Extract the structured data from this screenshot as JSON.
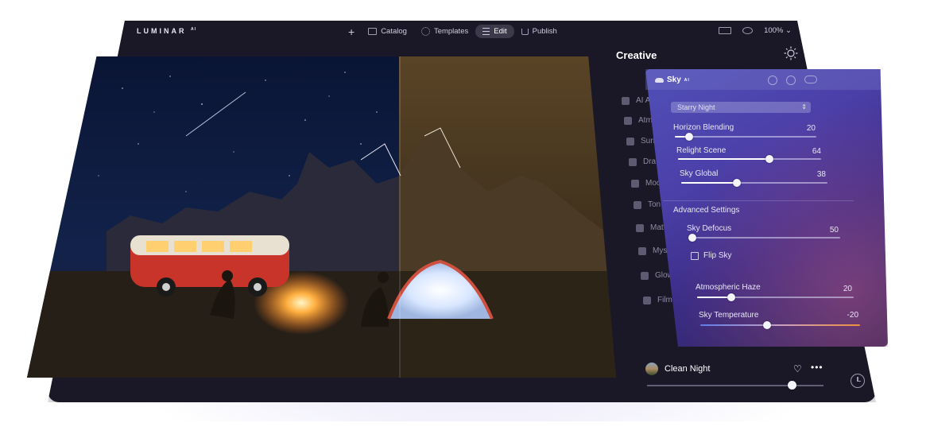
{
  "app": {
    "logo_text": "LUMINAR",
    "logo_sup": "AI"
  },
  "topbar": {
    "nav": [
      {
        "label": "Catalog",
        "icon": "folder-icon"
      },
      {
        "label": "Templates",
        "icon": "templates-icon"
      },
      {
        "label": "Edit",
        "icon": "edit-icon",
        "active": true
      },
      {
        "label": "Publish",
        "icon": "share-icon"
      }
    ],
    "zoom": "100%"
  },
  "sidebar": {
    "title": "Creative",
    "tools": [
      {
        "label": "AI A",
        "icon": "ai-icon"
      },
      {
        "label": "Atm",
        "icon": "atmosphere-icon"
      },
      {
        "label": "Sun",
        "icon": "sun-rays-icon"
      },
      {
        "label": "Dra",
        "icon": "drama-icon"
      },
      {
        "label": "Moo",
        "icon": "mood-icon"
      },
      {
        "label": "Ton",
        "icon": "toning-icon"
      },
      {
        "label": "Matt",
        "icon": "matte-icon"
      },
      {
        "label": "Myst",
        "icon": "mystical-icon"
      },
      {
        "label": "Glow",
        "icon": "glow-icon"
      },
      {
        "label": "Film",
        "icon": "film-icon"
      }
    ]
  },
  "sky_panel": {
    "title": "Sky",
    "title_sup": "AI",
    "preset_select": "Starry Night",
    "sliders": [
      {
        "label": "Horizon Blending",
        "value": "20",
        "fraction": 0.1
      },
      {
        "label": "Relight Scene",
        "value": "64",
        "fraction": 0.64
      },
      {
        "label": "Sky Global",
        "value": "38",
        "fraction": 0.38
      }
    ],
    "advanced_title": "Advanced Settings",
    "advanced_sliders": [
      {
        "label": "Sky Defocus",
        "value": "50",
        "fraction": 0.0
      }
    ],
    "flip_label": "Flip Sky",
    "flip_checked": false,
    "lower_sliders": [
      {
        "label": "Atmospheric Haze",
        "value": "20",
        "fraction": 0.22
      },
      {
        "label": "Sky Temperature",
        "value": "-20",
        "fraction": 0.42
      }
    ]
  },
  "preset": {
    "name": "Clean Night",
    "amount_fraction": 0.82
  }
}
